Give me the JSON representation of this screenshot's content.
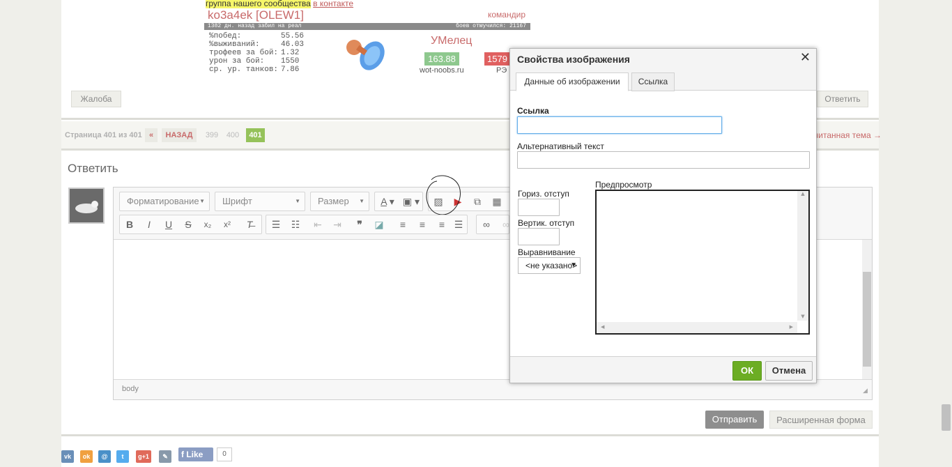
{
  "signature": {
    "community_text": "группа нашего сообщества",
    "vk_link": "в контакте",
    "player_name": "ko3a4ek [OLEW1]",
    "role": "командир",
    "bar_left": "1382 дн. назад забил на реал",
    "bar_right": "боев отмучился: 21167",
    "stats": [
      {
        "k": "%побед:",
        "v": "55.56"
      },
      {
        "k": "%выживаний:",
        "v": "46.03"
      },
      {
        "k": "трофеев за бой:",
        "v": "1.32"
      },
      {
        "k": "урон за бой:",
        "v": "1550"
      },
      {
        "k": "ср. ур. танков:",
        "v": "7.86"
      }
    ],
    "rank": "УМелец",
    "rating_green": "163.88",
    "rating_red": "1579",
    "site": "wot-noobs.ru",
    "re_label": "РЭ"
  },
  "post_actions": {
    "complaint": "Жалоба",
    "reply": "Ответить"
  },
  "pagination": {
    "label": "Страница 401 из 401",
    "first": "«",
    "back": "НАЗАД",
    "pages": [
      "399",
      "400",
      "401"
    ],
    "current": "401",
    "unread": "читанная тема →"
  },
  "reply": {
    "title": "Ответить"
  },
  "editor": {
    "format": "Форматирование",
    "font": "Шрифт",
    "size": "Размер",
    "path": "body"
  },
  "dialog": {
    "title": "Свойства изображения",
    "close": "✕",
    "tabs": [
      "Данные об изображении",
      "Ссылка"
    ],
    "url_label": "Ссылка",
    "url_value": "",
    "alt_label": "Альтернативный текст",
    "hspace_label": "Гориз. отступ",
    "vspace_label": "Вертик. отступ",
    "align_label": "Выравнивание",
    "align_value": "<не указано>",
    "preview_label": "Предпросмотр",
    "ok": "ОК",
    "cancel": "Отмена"
  },
  "buttons": {
    "send": "Отправить",
    "extended": "Расширенная форма"
  },
  "social": {
    "like": "Like",
    "count": "0"
  },
  "colors": {
    "accent_green": "#95c25a",
    "link_red": "#c86a6a",
    "ok_green": "#6cad24"
  }
}
